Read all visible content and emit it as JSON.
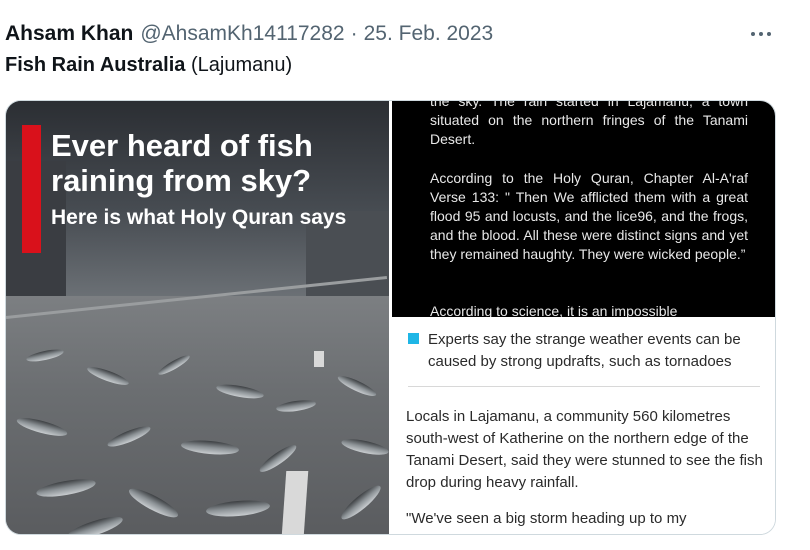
{
  "tweet": {
    "author_name": "Ahsam Khan",
    "author_handle": "@AhsamKh14117282",
    "separator": "·",
    "timestamp": "25. Feb. 2023",
    "more_icon": "more-horizontal-icon",
    "text_bold": "Fish Rain Australia",
    "text_rest": "(Lajumanu)"
  },
  "media": {
    "left_image": {
      "headline": "Ever heard of fish raining from sky?",
      "subheadline": "Here is what Holy Quran says",
      "accent_color": "#d9111b"
    },
    "right_top": {
      "paragraphs": [
        "the sky. The rain started in Lajamanu, a town situated on the northern fringes of the Tanami Desert.",
        "According to the Holy Quran, Chapter Al-A'raf Verse 133: \" Then We afflicted them with a great flood 95 and locusts, and the lice96, and the frogs, and the blood. All these were distinct signs and yet they remained haughty. They were wicked people.”",
        "According to science, it is an impossible"
      ]
    },
    "right_bottom": {
      "bullet_color": "#1fb6e6",
      "bullet_text": "Experts say the strange weather events can be caused by strong updrafts, such as tornadoes",
      "paragraphs": [
        "Locals in Lajamanu, a community 560 kilometres south-west of Katherine on the northern edge of the Tanami Desert, said they were stunned to see the fish drop during heavy rainfall.",
        "\"We've seen a big storm heading up to my"
      ]
    }
  }
}
